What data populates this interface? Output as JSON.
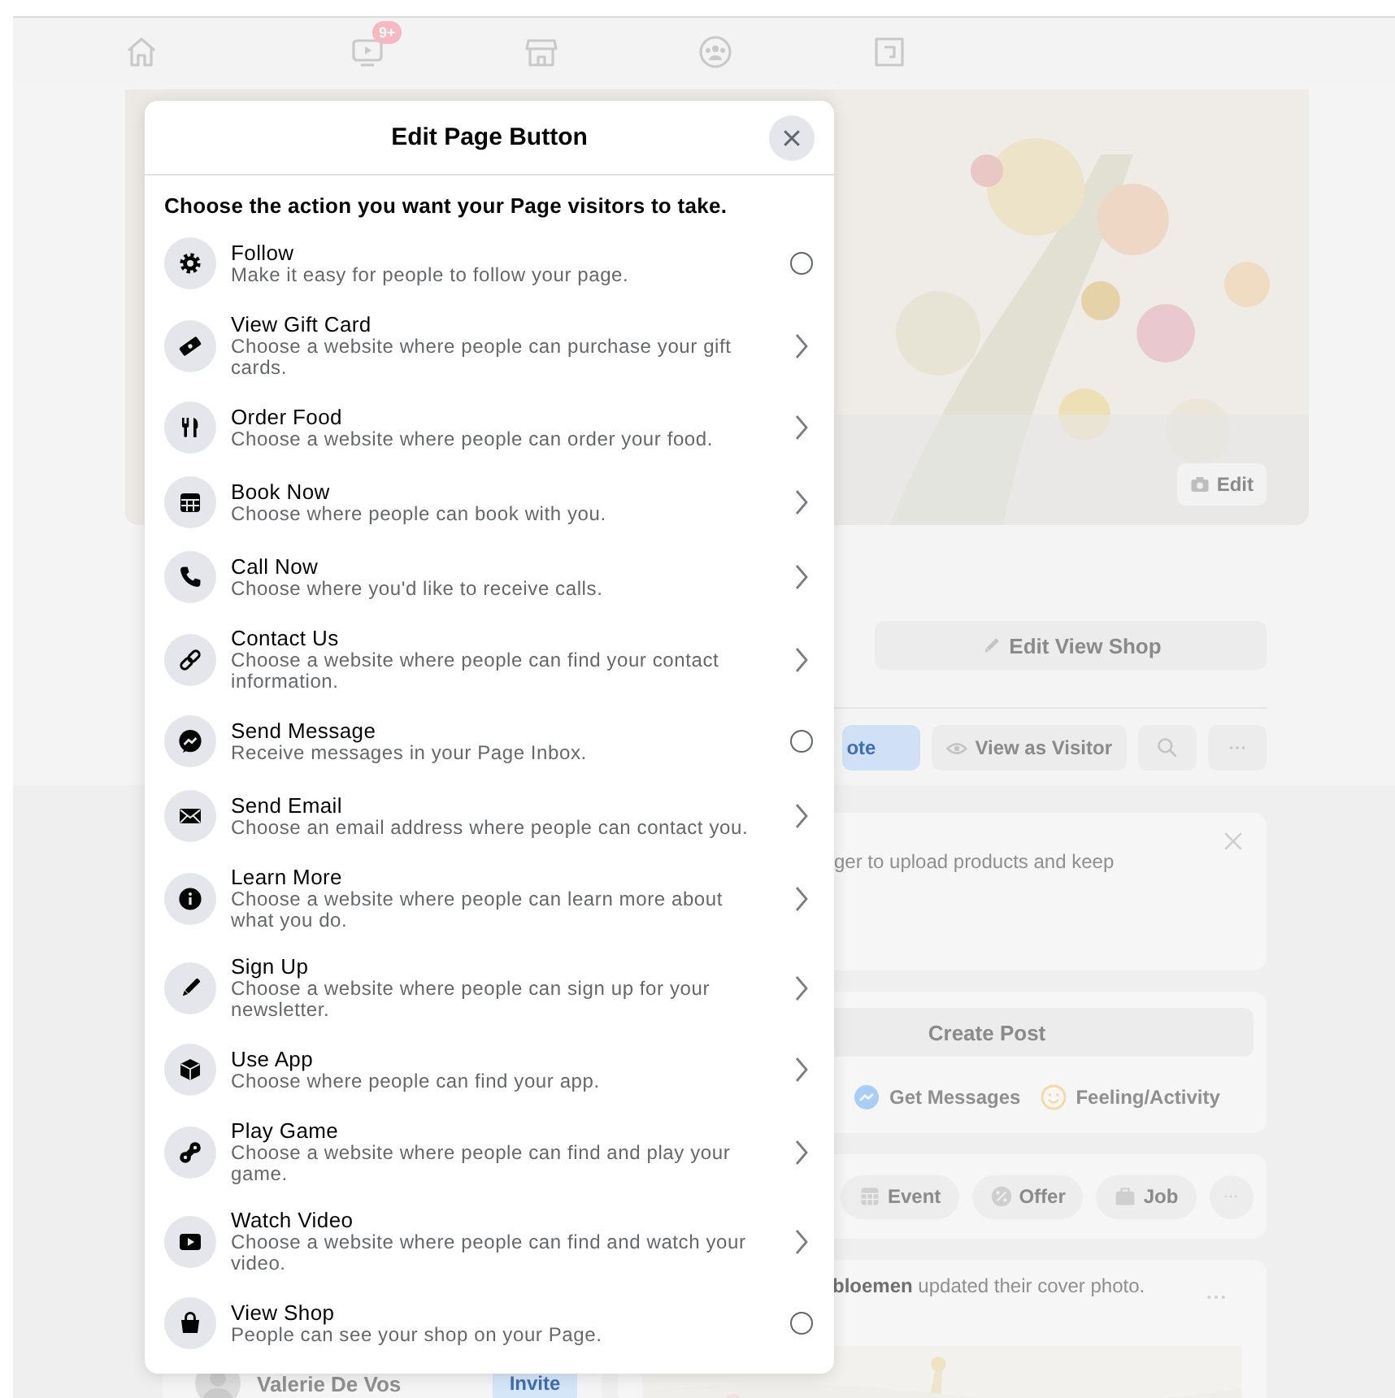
{
  "nav": {
    "video_badge": "9+"
  },
  "modal": {
    "title": "Edit Page Button",
    "prompt": "Choose the action you want your Page visitors to take.",
    "actions": [
      {
        "title": "Follow",
        "description": "Make it easy for people to follow your page.",
        "kind": "radio",
        "selected": false
      },
      {
        "title": "View Gift Card",
        "description": "Choose a website where people can purchase your gift cards.",
        "kind": "link"
      },
      {
        "title": "Order Food",
        "description": "Choose a website where people can order your food.",
        "kind": "link"
      },
      {
        "title": "Book Now",
        "description": "Choose where people can book with you.",
        "kind": "link"
      },
      {
        "title": "Call Now",
        "description": "Choose where you'd like to receive calls.",
        "kind": "link"
      },
      {
        "title": "Contact Us",
        "description": "Choose a website where people can find your contact information.",
        "kind": "link"
      },
      {
        "title": "Send Message",
        "description": "Receive messages in your Page Inbox.",
        "kind": "radio",
        "selected": false
      },
      {
        "title": "Send Email",
        "description": "Choose an email address where people can contact you.",
        "kind": "link"
      },
      {
        "title": "Learn More",
        "description": "Choose a website where people can learn more about what you do.",
        "kind": "link"
      },
      {
        "title": "Sign Up",
        "description": "Choose a website where people can sign up for your newsletter.",
        "kind": "link"
      },
      {
        "title": "Use App",
        "description": "Choose where people can find your app.",
        "kind": "link"
      },
      {
        "title": "Play Game",
        "description": "Choose a website where people can find and play your game.",
        "kind": "link"
      },
      {
        "title": "Watch Video",
        "description": "Choose a website where people can find and watch your video.",
        "kind": "link"
      },
      {
        "title": "View Shop",
        "description": "People can see your shop on your Page.",
        "kind": "radio",
        "selected": false
      }
    ]
  },
  "cover": {
    "edit_button": "Edit"
  },
  "profile": {
    "edit_button": "Edit View Shop",
    "primary_button": "ote",
    "visitor_button": "View as Visitor"
  },
  "notice_card": {
    "text": "ger to upload products and keep"
  },
  "create_post": {
    "button": "Create Post",
    "actions": [
      "Get Messages",
      "Feeling/Activity"
    ]
  },
  "post_types": [
    "Event",
    "Offer",
    "Job"
  ],
  "activity": {
    "text": "**bloemen** updated their cover photo."
  },
  "invite_row": {
    "name": "Valerie De Vos",
    "button": "Invite"
  }
}
